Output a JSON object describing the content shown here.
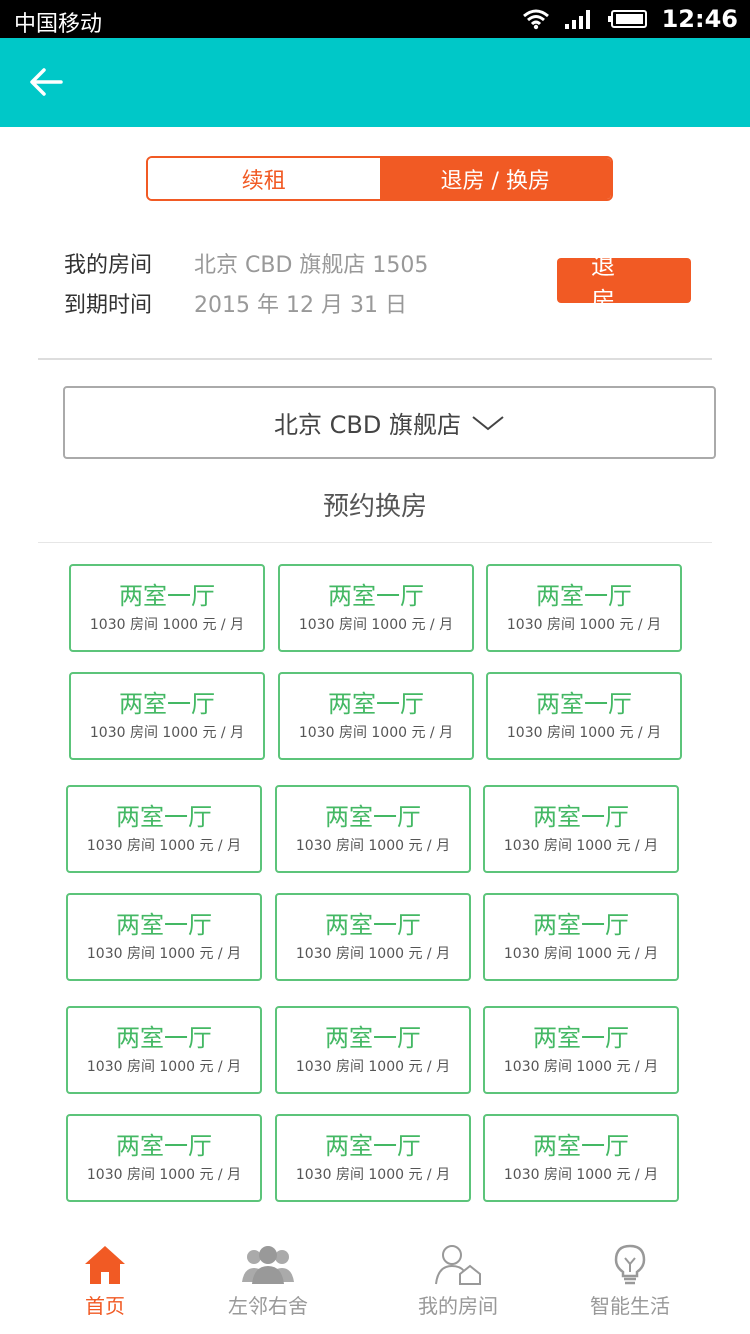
{
  "status_bar": {
    "carrier": "中国移动",
    "time": "12:46"
  },
  "segment": {
    "renew": "续租",
    "checkout_swap": "退房 / 换房"
  },
  "info": {
    "room_label": "我的房间",
    "room_value": "北京 CBD 旗舰店 1505",
    "expiry_label": "到期时间",
    "expiry_value": "2015 年 12 月 31 日"
  },
  "checkout_button": "退房",
  "store_select": "北京 CBD 旗舰店",
  "section_title": "预约换房",
  "rooms": [
    {
      "type": "两室一厅",
      "price": "1030 房间 1000 元 / 月"
    },
    {
      "type": "两室一厅",
      "price": "1030 房间 1000 元 / 月"
    },
    {
      "type": "两室一厅",
      "price": "1030 房间 1000 元 / 月"
    },
    {
      "type": "两室一厅",
      "price": "1030 房间 1000 元 / 月"
    },
    {
      "type": "两室一厅",
      "price": "1030 房间 1000 元 / 月"
    },
    {
      "type": "两室一厅",
      "price": "1030 房间 1000 元 / 月"
    },
    {
      "type": "两室一厅",
      "price": "1030 房间 1000 元 / 月"
    },
    {
      "type": "两室一厅",
      "price": "1030 房间 1000 元 / 月"
    },
    {
      "type": "两室一厅",
      "price": "1030 房间 1000 元 / 月"
    },
    {
      "type": "两室一厅",
      "price": "1030 房间 1000 元 / 月"
    },
    {
      "type": "两室一厅",
      "price": "1030 房间 1000 元 / 月"
    },
    {
      "type": "两室一厅",
      "price": "1030 房间 1000 元 / 月"
    },
    {
      "type": "两室一厅",
      "price": "1030 房间 1000 元 / 月"
    },
    {
      "type": "两室一厅",
      "price": "1030 房间 1000 元 / 月"
    },
    {
      "type": "两室一厅",
      "price": "1030 房间 1000 元 / 月"
    },
    {
      "type": "两室一厅",
      "price": "1030 房间 1000 元 / 月"
    },
    {
      "type": "两室一厅",
      "price": "1030 房间 1000 元 / 月"
    },
    {
      "type": "两室一厅",
      "price": "1030 房间 1000 元 / 月"
    }
  ],
  "tabs": [
    {
      "label": "首页",
      "icon": "home-icon"
    },
    {
      "label": "左邻右舍",
      "icon": "neighbors-icon"
    },
    {
      "label": "我的房间",
      "icon": "my-room-icon"
    },
    {
      "label": "智能生活",
      "icon": "lightbulb-icon"
    }
  ],
  "colors": {
    "header": "#00c8c8",
    "accent": "#f15a24",
    "card_green": "#5cc47a"
  }
}
